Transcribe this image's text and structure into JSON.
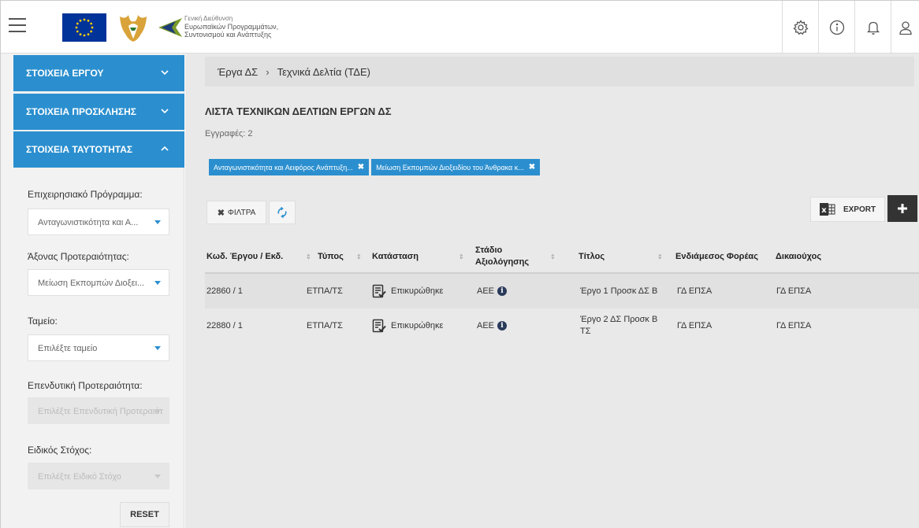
{
  "header": {
    "dept_line1": "Γενική Διεύθυνση",
    "dept_line2": "Ευρωπαϊκών Προγραμμάτων,",
    "dept_line3": "Συντονισμού και Ανάπτυξης"
  },
  "sidebar": {
    "sections": [
      {
        "label": "ΣΤΟΙΧΕΙΑ ΕΡΓΟΥ",
        "expanded": false
      },
      {
        "label": "ΣΤΟΙΧΕΙΑ ΠΡΟΣΚΛΗΣΗΣ",
        "expanded": false
      },
      {
        "label": "ΣΤΟΙΧΕΙΑ ΤΑΥΤΟΤΗΤΑΣ",
        "expanded": true
      }
    ],
    "fields": [
      {
        "label": "Επιχειρησιακό Πρόγραμμα:",
        "value": "Ανταγωνιστικότητα και Α...",
        "disabled": false
      },
      {
        "label": "Άξονας Προτεραιότητας:",
        "value": "Μείωση Εκπομπών Διοξει...",
        "disabled": false
      },
      {
        "label": "Ταμείο:",
        "value": "Επιλέξτε ταμείο",
        "disabled": false
      },
      {
        "label": "Επενδυτική Προτεραιότητα:",
        "value": "Επιλέξτε Επενδυτική Προτεραιότ",
        "disabled": true
      },
      {
        "label": "Ειδικός Στόχος:",
        "value": "Επιλέξτε Ειδικό Στόχο",
        "disabled": true
      }
    ],
    "reset_label": "RESET"
  },
  "main": {
    "breadcrumb": [
      "Έργα ΔΣ",
      "Τεχνικά Δελτία (ΤΔΕ)"
    ],
    "title": "ΛΙΣΤΑ ΤΕΧΝΙΚΩΝ ΔΕΛΤΙΩΝ ΕΡΓΩΝ ΔΣ",
    "records": "Εγγραφές: 2",
    "chips": [
      "Ανταγωνιστικότητα και Αειφόρος Ανάπτυξη...",
      "Μείωση Εκπομπών Διοξειδίου του Άνθρακα κ..."
    ],
    "filters_label": "ΦΙΛΤΡΑ",
    "export_label": "EXPORT",
    "accent_color": "#2b8fcf"
  },
  "table": {
    "columns": [
      "Κωδ. Έργου / Εκδ.",
      "Τύπος",
      "Κατάσταση",
      "Στάδιο Αξιολόγησης",
      "Τίτλος",
      "Ενδιάμεσος Φορέας",
      "Δικαιούχος"
    ],
    "column_line1": [
      "Κωδ. Έργου / Εκδ.",
      "Τύπος",
      "Κατάσταση",
      "Στάδιο",
      "Τίτλος",
      "Ενδιάμεσος Φορέας",
      "Δικαιούχος"
    ],
    "column_line2": [
      "",
      "",
      "",
      "Αξιολόγησης",
      "",
      "",
      ""
    ],
    "rows": [
      {
        "code": "22860 / 1",
        "type": "ΕΤΠΑ/ΤΣ",
        "status": "Επικυρώθηκε",
        "stage": "ΑΕΕ",
        "title_l1": "Έργο 1 Προσκ ΔΣ Β",
        "title_l2": "",
        "body": "ΓΔ ΕΠΣΑ",
        "beneficiary": "ΓΔ ΕΠΣΑ"
      },
      {
        "code": "22880 / 1",
        "type": "ΕΤΠΑ/ΤΣ",
        "status": "Επικυρώθηκε",
        "stage": "ΑΕΕ",
        "title_l1": "Έργο 2 ΔΣ Προσκ Β",
        "title_l2": "ΤΣ",
        "body": "ΓΔ ΕΠΣΑ",
        "beneficiary": "ΓΔ ΕΠΣΑ"
      }
    ]
  }
}
